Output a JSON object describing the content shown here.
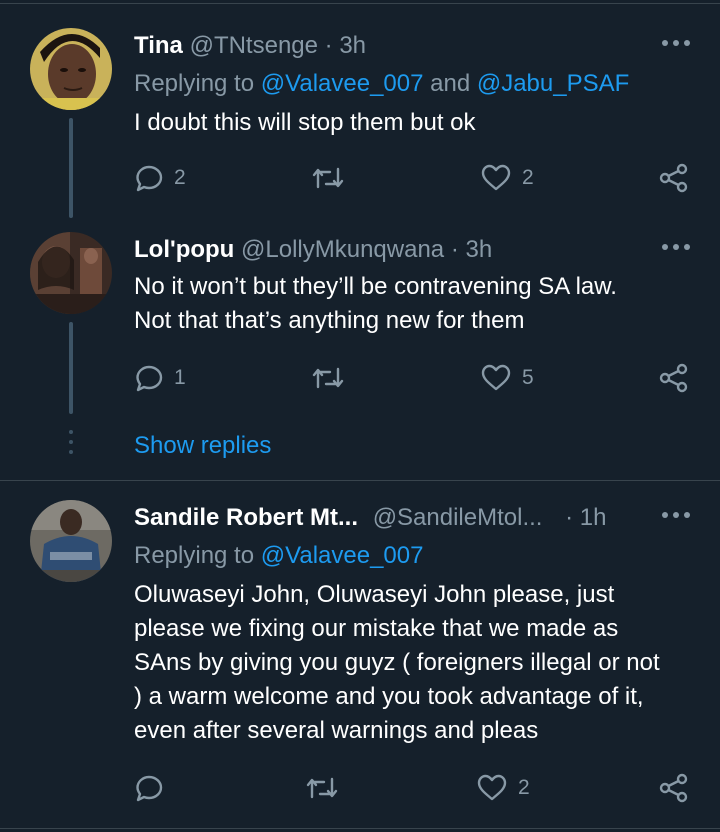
{
  "tweets": [
    {
      "name": "Tina",
      "handle": "@TNtsenge",
      "sep": " · ",
      "time": "3h",
      "replying_prefix": "Replying to ",
      "replying_1": "@Valavee_007",
      "replying_and": " and ",
      "replying_2": "@Jabu_PSAF",
      "body": "I doubt this will stop them but ok",
      "replies": "2",
      "retweets": "",
      "likes": "2"
    },
    {
      "name": "Lol'popu",
      "handle": "@LollyMkunqwana",
      "sep": " · ",
      "time": "3h",
      "body_line1": "No it won’t but they’ll be contravening SA law.",
      "body_line2": "Not that that’s anything new for them",
      "replies": "1",
      "retweets": "",
      "likes": "5"
    },
    {
      "name": "Sandile Robert Mt...",
      "handle": "@SandileMtol...",
      "sep": " · ",
      "time": "1h",
      "replying_prefix": "Replying to ",
      "replying_1": "@Valavee_007",
      "body_lines": [
        "Oluwaseyi John, Oluwaseyi John please, just",
        "please we fixing our mistake that we made as",
        "SAns by giving you guyz ( foreigners illegal or not",
        ") a warm welcome and you took advantage of it,",
        "even after several warnings and pleas"
      ],
      "replies": "",
      "retweets": "",
      "likes": "2"
    }
  ],
  "show_replies": "Show replies",
  "colors": {
    "background": "#15202b",
    "secondary_text": "#8899a6",
    "link": "#1d9bf0",
    "divider": "#38444d"
  },
  "icons": [
    "reply-icon",
    "retweet-icon",
    "like-icon",
    "share-icon",
    "more-icon"
  ]
}
